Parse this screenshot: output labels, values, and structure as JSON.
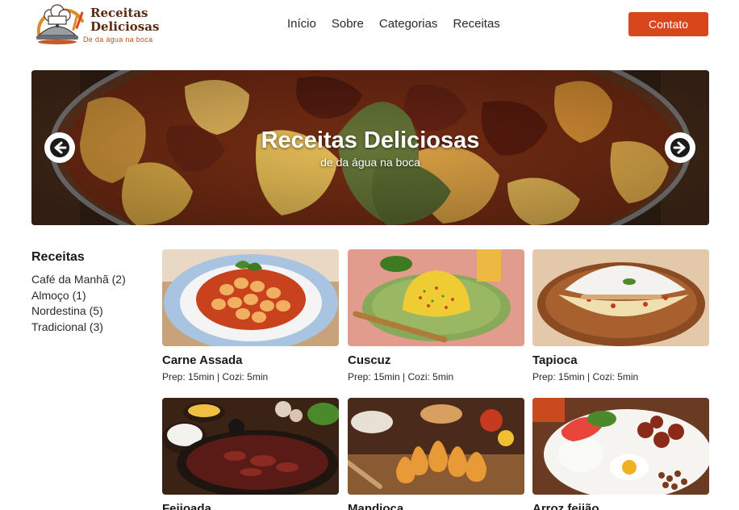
{
  "brand": {
    "title_line1": "Receitas",
    "title_line2": "Deliciosas",
    "tagline": "De da água na boca"
  },
  "nav": {
    "items": [
      "Início",
      "Sobre",
      "Categorias",
      "Receitas"
    ]
  },
  "contact_label": "Contato",
  "hero": {
    "title": "Receitas Deliciosas",
    "subtitle": "de da água na boca",
    "prev_icon": "arrow-left-icon",
    "next_icon": "arrow-right-icon"
  },
  "sidebar": {
    "title": "Receitas",
    "items": [
      "Café da Manhã (2)",
      "Almoço (1)",
      "Nordestina (5)",
      "Tradicional (3)"
    ]
  },
  "cards": [
    {
      "title": "Carne Assada",
      "meta": "Prep: 15min | Cozi: 5min"
    },
    {
      "title": "Cuscuz",
      "meta": "Prep: 15min | Cozi: 5min"
    },
    {
      "title": "Tapioca",
      "meta": "Prep: 15min | Cozi: 5min"
    },
    {
      "title": "Feijoada",
      "meta": ""
    },
    {
      "title": "Mandioca",
      "meta": ""
    },
    {
      "title": "Arroz feijão",
      "meta": ""
    }
  ],
  "colors": {
    "accent": "#d8461c",
    "logo_text": "#5a2a12",
    "logo_tagline": "#b8541f"
  }
}
